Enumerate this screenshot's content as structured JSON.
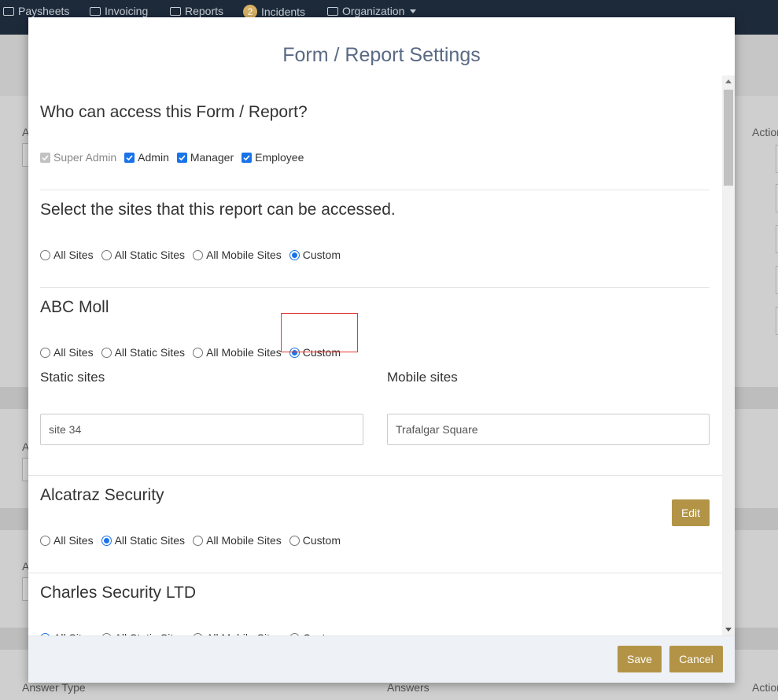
{
  "topnav": {
    "items": [
      {
        "label": "Paysheets",
        "icon": "money-icon"
      },
      {
        "label": "Invoicing",
        "icon": "invoice-icon"
      },
      {
        "label": "Reports",
        "icon": "table-icon"
      },
      {
        "label": "Incidents",
        "badge": "2"
      },
      {
        "label": "Organization",
        "icon": "users-icon"
      }
    ]
  },
  "background": {
    "labels": [
      "A",
      "A",
      "A",
      "Answer Type",
      "Answers",
      "Action",
      "Action"
    ]
  },
  "modal": {
    "title": "Form / Report Settings",
    "access": {
      "heading": "Who can access this Form / Report?",
      "roles": [
        {
          "label": "Super Admin",
          "checked": true,
          "disabled": true
        },
        {
          "label": "Admin",
          "checked": true,
          "disabled": false
        },
        {
          "label": "Manager",
          "checked": true,
          "disabled": false
        },
        {
          "label": "Employee",
          "checked": true,
          "disabled": false
        }
      ]
    },
    "site_scope_labels": [
      "All Sites",
      "All Static Sites",
      "All Mobile Sites",
      "Custom"
    ],
    "sites_access": {
      "heading": "Select the sites that this report can be accessed.",
      "selected": "Custom"
    },
    "companies": [
      {
        "name": "ABC Moll",
        "selected": "Custom",
        "static_label": "Static sites",
        "mobile_label": "Mobile sites",
        "static_value": "site 34",
        "mobile_value": "Trafalgar Square"
      },
      {
        "name": "Alcatraz Security",
        "selected": "All Static Sites",
        "edit_label": "Edit"
      },
      {
        "name": "Charles Security LTD",
        "selected": "All Sites"
      }
    ],
    "footer": {
      "save_label": "Save",
      "cancel_label": "Cancel"
    }
  },
  "colors": {
    "accent": "#b39447",
    "radio_checked": "#1a73e8",
    "title": "#5a6a85",
    "highlight": "#e53935"
  }
}
